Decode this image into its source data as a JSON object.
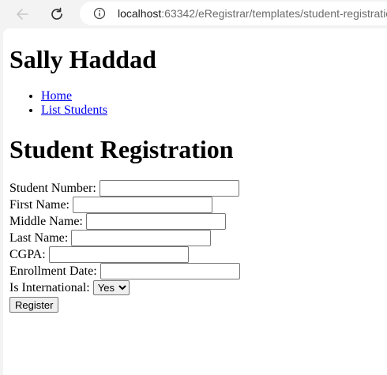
{
  "browser": {
    "url_host": "localhost",
    "url_rest": ":63342/eRegistrar/templates/student-registratio"
  },
  "page": {
    "site_title": "Sally Haddad",
    "nav": [
      {
        "label": "Home"
      },
      {
        "label": "List Students"
      }
    ],
    "heading": "Student Registration"
  },
  "form": {
    "fields": [
      {
        "label": "Student Number:",
        "value": ""
      },
      {
        "label": "First Name:",
        "value": ""
      },
      {
        "label": "Middle Name:",
        "value": ""
      },
      {
        "label": "Last Name:",
        "value": ""
      },
      {
        "label": "CGPA:",
        "value": ""
      },
      {
        "label": "Enrollment Date:",
        "value": ""
      }
    ],
    "international": {
      "label": "Is International:",
      "selected": "Yes"
    },
    "submit_label": "Register"
  },
  "icons": {
    "back": "arrow-left-icon",
    "reload": "reload-icon",
    "info": "info-circle-icon"
  }
}
